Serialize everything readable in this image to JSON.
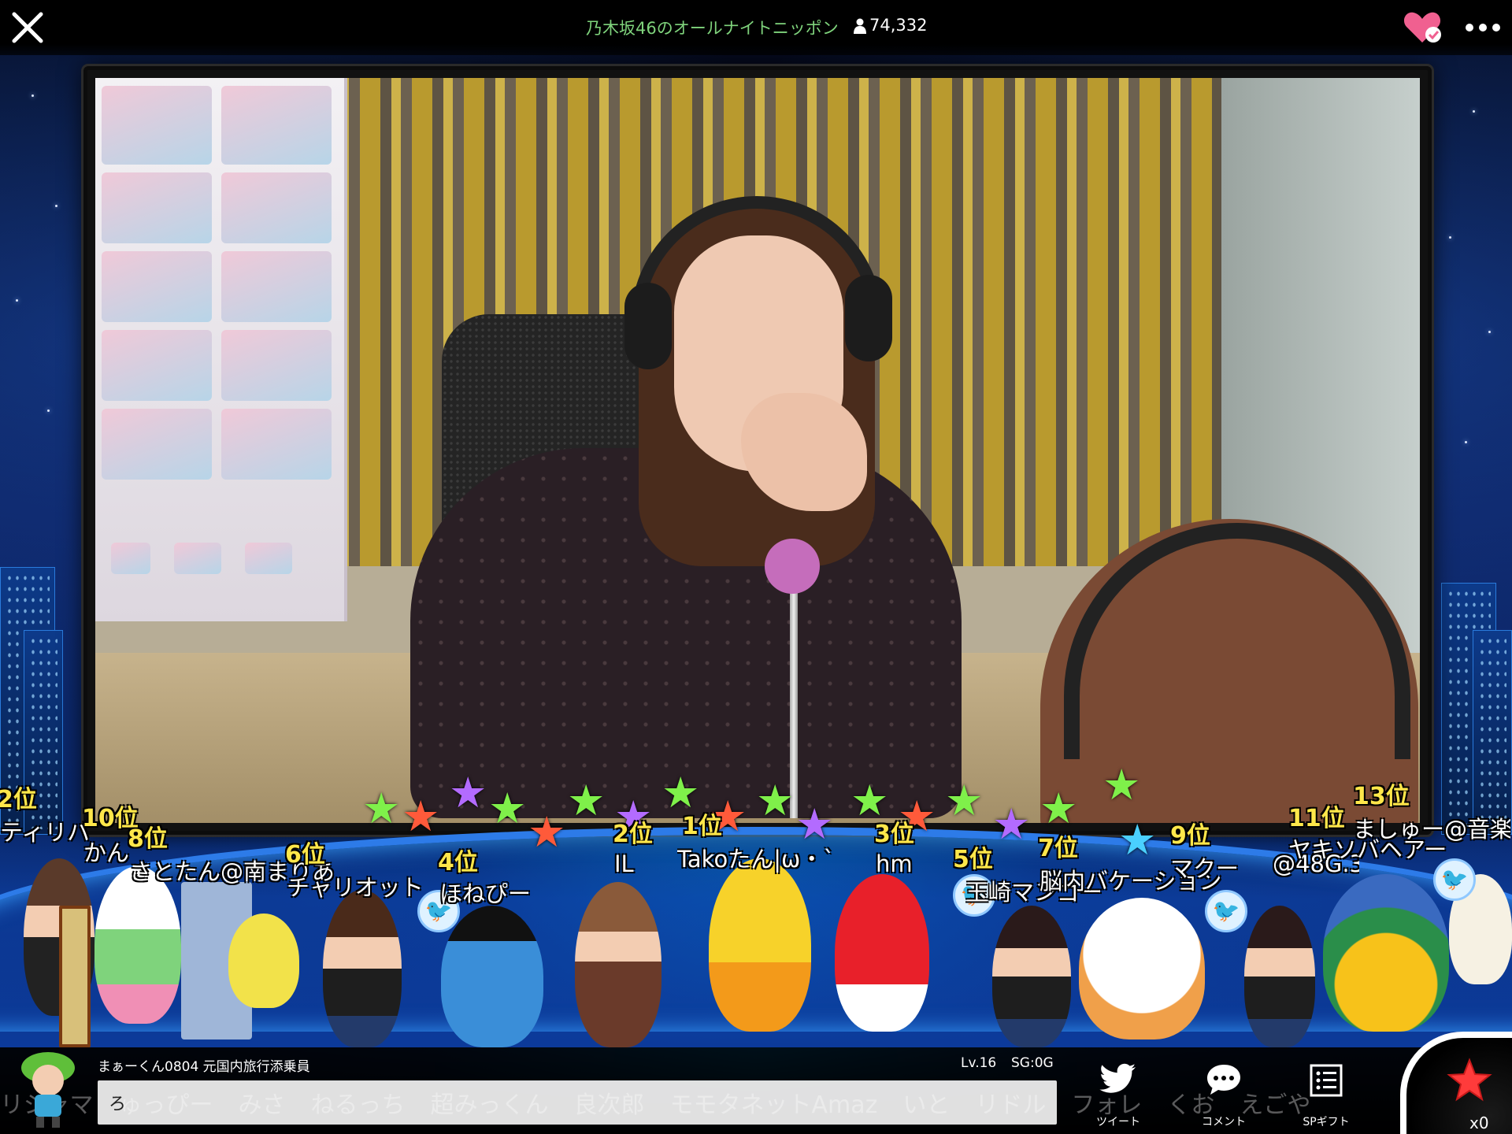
{
  "header": {
    "title": "乃木坂46のオールナイトニッポン",
    "viewer_count": "74,332"
  },
  "icons": {
    "close": "close-icon",
    "viewers": "person-icon",
    "favorite": "heart-check-icon",
    "more": "more-dots-icon"
  },
  "rankings": [
    {
      "rank": "2位",
      "name": "ティリバ"
    },
    {
      "rank": "10位",
      "name": "かん"
    },
    {
      "rank": "8位",
      "name": "さとたん@南まりあ"
    },
    {
      "rank": "6位",
      "name": "チャリオット"
    },
    {
      "rank": "4位",
      "name": "ほねぴー"
    },
    {
      "rank": "2位",
      "name": "IL"
    },
    {
      "rank": "1位",
      "name": "Takoたん|ω・`"
    },
    {
      "rank": "3位",
      "name": "hm"
    },
    {
      "rank": "5位",
      "name": "玉崎マンゴー"
    },
    {
      "rank": "7位",
      "name": "脳内バケーション"
    },
    {
      "rank": "9位",
      "name": "マクー"
    },
    {
      "rank": "11位",
      "name": "ヤキソバヘアー"
    },
    {
      "rank": "13位",
      "name": "ましゅー@音楽"
    }
  ],
  "rank_extra": "@48G.3",
  "ticker_comments": [
    "リジャマ",
    "ゅっぴー",
    "みさ",
    "ねるっち",
    "超みっくん",
    "良次郎",
    "モモタネットAmaz",
    "いと",
    "リドル",
    "フォレ",
    "くお",
    "えごや"
  ],
  "user": {
    "name": "まぁーくん0804 元国内旅行添乗員",
    "level": "Lv.16",
    "sg": "SG:0G"
  },
  "comment": {
    "value": "ろ",
    "placeholder": ""
  },
  "actions": {
    "tweet": "ツイート",
    "comment": "コメント",
    "sp_gift": "SPギフト"
  },
  "star_count": "x0",
  "colors": {
    "title": "#7fd37c",
    "rank": "#ffe74a",
    "heart": "#f06090",
    "star": "#ff3b3b"
  }
}
